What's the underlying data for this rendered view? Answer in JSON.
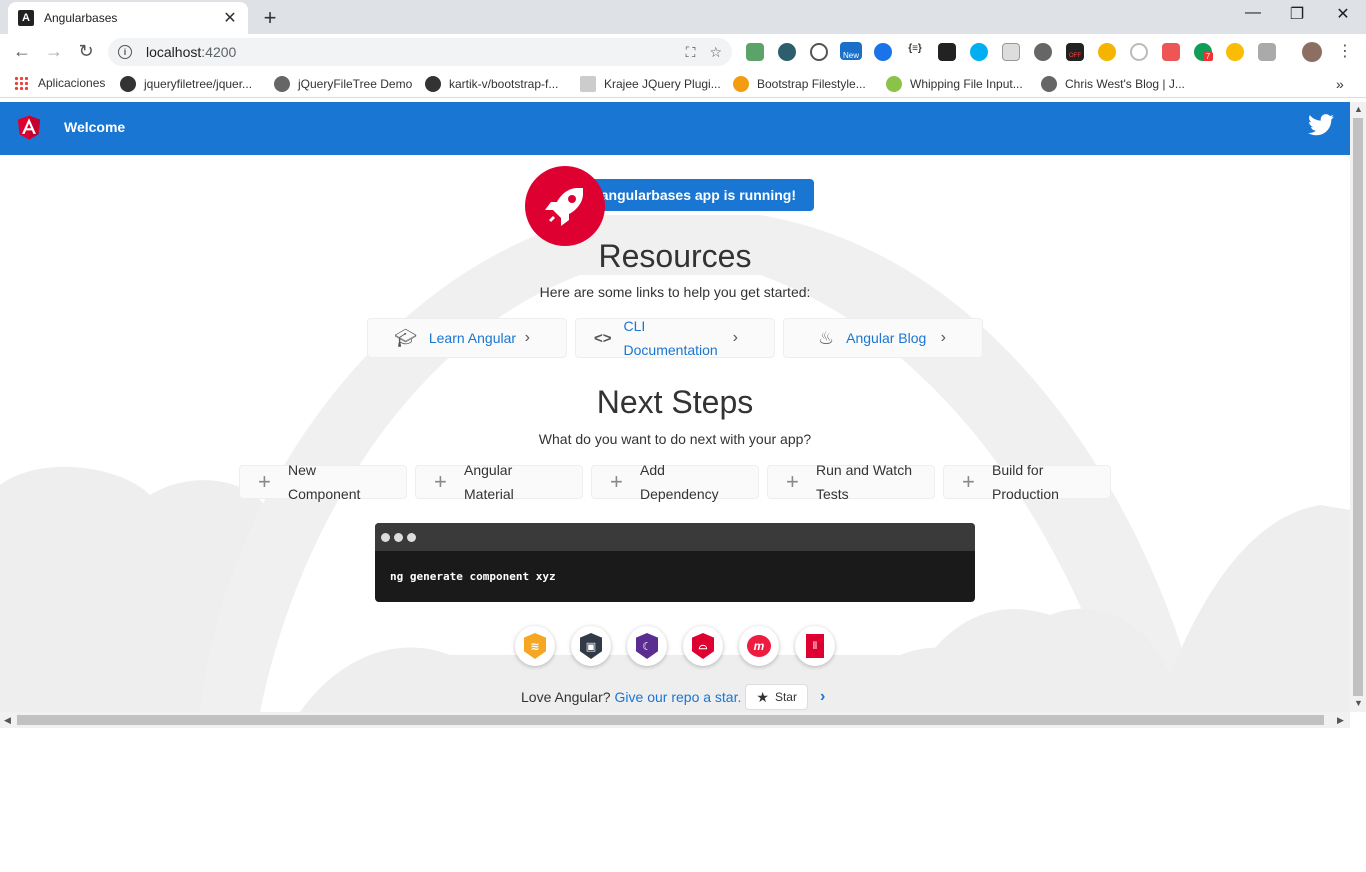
{
  "browser": {
    "tab_title": "Angularbases",
    "tab_close": "✕",
    "new_tab": "+",
    "url_host": "localhost",
    "url_port": ":4200",
    "extensions": [
      "evernote",
      "spiral",
      "zoom",
      "new-badge",
      "check",
      "json",
      "terminal",
      "skype",
      "calendar",
      "circle",
      "off",
      "moon",
      "snail",
      "pdf",
      "7-badge",
      "magnifier",
      "code",
      "avatar"
    ],
    "extension_badges": {
      "new": "New",
      "count": "7",
      "off": "OFF"
    },
    "bookmarks": [
      "Aplicaciones",
      "jqueryfiletree/jquer...",
      "jQueryFileTree Demo",
      "kartik-v/bootstrap-f...",
      "Krajee JQuery Plugi...",
      "Bootstrap Filestyle...",
      "Whipping File Input...",
      "Chris West's Blog | J..."
    ],
    "more": "»"
  },
  "app": {
    "header_title": "Welcome",
    "running": "angularbases app is running!",
    "resources_title": "Resources",
    "resources_sub": "Here are some links to help you get started:",
    "resources": [
      {
        "label": "Learn Angular",
        "icon": "graduation-cap-icon"
      },
      {
        "label": "CLI\nDocumentation",
        "icon": "code-icon"
      },
      {
        "label": "Angular Blog",
        "icon": "flame-icon"
      }
    ],
    "steps_title": "Next Steps",
    "steps_sub": "What do you want to do next with your app?",
    "steps": [
      {
        "label": "New\nComponent"
      },
      {
        "label": "Angular\nMaterial"
      },
      {
        "label": "Add\nDependency"
      },
      {
        "label": "Run and Watch\nTests"
      },
      {
        "label": "Build for\nProduction"
      }
    ],
    "terminal_cmd": "ng generate component xyz",
    "tools": [
      {
        "name": "animations",
        "color": "#f5a623"
      },
      {
        "name": "cli",
        "color": "#333a47"
      },
      {
        "name": "augury",
        "color": "#5c2d91"
      },
      {
        "name": "protractor",
        "color": "#dd0031"
      },
      {
        "name": "meetup",
        "color": "#ed1c40"
      },
      {
        "name": "discord",
        "color": "#dd0031"
      }
    ],
    "love_text": "Love Angular?",
    "love_link": "Give our repo a star.",
    "star_label": "Star",
    "colors": {
      "primary": "#1976d2",
      "angular_red": "#dd0031"
    }
  }
}
